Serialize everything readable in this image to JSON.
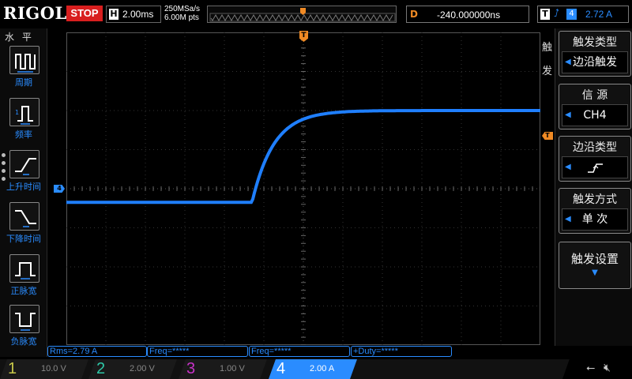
{
  "topbar": {
    "logo": "RIGOL",
    "run_state": "STOP",
    "h_letter": "H",
    "timebase": "2.00ms",
    "sample_rate": "250MSa/s",
    "memory_depth": "6.00M pts",
    "delay_letter": "D",
    "delay_value": "-240.000000ns",
    "trigger_letter": "T",
    "trigger_source_num": "4",
    "trigger_level": "2.72 A",
    "trigger_pos_marker": "T"
  },
  "left_menu": {
    "title": "水 平",
    "items": [
      {
        "label": "周期",
        "icon": "period-icon"
      },
      {
        "label": "频率",
        "icon": "frequency-icon"
      },
      {
        "label": "上升时间",
        "icon": "rise-time-icon"
      },
      {
        "label": "下降时间",
        "icon": "fall-time-icon"
      },
      {
        "label": "正脉宽",
        "icon": "positive-width-icon"
      },
      {
        "label": "负脉宽",
        "icon": "negative-width-icon"
      }
    ]
  },
  "right_menu": {
    "vertical_title": "触发",
    "trigger_type_label": "触发类型",
    "trigger_type_value": "边沿触发",
    "source_label": "信 源",
    "source_value": "CH4",
    "edge_type_label": "边沿类型",
    "edge_type_icon": "rising-edge-icon",
    "sweep_label": "触发方式",
    "sweep_value": "单 次",
    "trigger_settings_label": "触发设置"
  },
  "measurements": {
    "rms": "Rms=2.79 A",
    "freq1": "Freq=*****",
    "freq2": "Freq=*****",
    "duty": "+Duty=*****"
  },
  "channels": [
    {
      "num": "1",
      "scale": "10.0 V",
      "color": "#c8c84a"
    },
    {
      "num": "2",
      "scale": "2.00 V",
      "color": "#2ec8a8"
    },
    {
      "num": "3",
      "scale": "1.00 V",
      "color": "#c832c8"
    },
    {
      "num": "4",
      "scale": "2.00 A",
      "color": "#2a8cff"
    }
  ],
  "ch4_marker": "4",
  "trig_level_marker": "T",
  "colors": {
    "trace": "#1f7fff",
    "stop": "#d81e1e",
    "trigger_marker": "#f08a24"
  },
  "waveform": {
    "low_level_div": -0.35,
    "high_level_div": 2.0,
    "edge_time_div": 4.7,
    "rise_time_constant_div": 0.55
  }
}
